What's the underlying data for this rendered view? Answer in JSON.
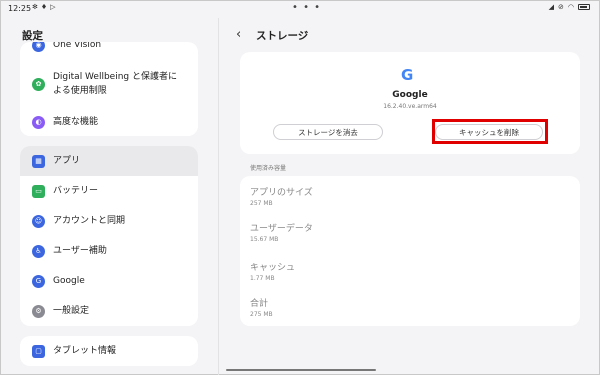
{
  "status_bar": {
    "time": "12:25",
    "left_icons": [
      "settings-small-icon",
      "wifi-small-icon",
      "play-store-small-icon"
    ],
    "center": "• • •"
  },
  "left_pane": {
    "title": "設定",
    "card1_items": [
      {
        "label": "One Vision",
        "icon": "vision-icon",
        "color": "#3b66e0"
      },
      {
        "label": "Digital Wellbeing と保護者に\nよる使用制限",
        "icon": "wellbeing-icon",
        "color": "#2fae5b"
      },
      {
        "label": "高度な機能",
        "icon": "advanced-features-icon",
        "color": "#8a5cf5"
      }
    ],
    "card2_items": [
      {
        "label": "アプリ",
        "icon": "apps-icon",
        "color": "#3b66e0"
      },
      {
        "label": "バッテリー",
        "icon": "battery-icon",
        "color": "#2fae5b"
      },
      {
        "label": "アカウントと同期",
        "icon": "account-icon",
        "color": "#3b66e0"
      },
      {
        "label": "ユーザー補助",
        "icon": "accessibility-icon",
        "color": "#3b66e0"
      },
      {
        "label": "Google",
        "icon": "google-icon",
        "color": "#3b66e0"
      },
      {
        "label": "一般設定",
        "icon": "general-settings-icon",
        "color": "#8a8a92"
      }
    ],
    "card3_items": [
      {
        "label": "タブレット情報",
        "icon": "tablet-info-icon",
        "color": "#3b66e0"
      }
    ]
  },
  "right_pane": {
    "title": "ストレージ",
    "app": {
      "name": "Google",
      "version": "16.2.40.ve.arm64",
      "logo": "G"
    },
    "buttons": {
      "clear_storage": "ストレージを消去",
      "clear_cache": "キャッシュを削除"
    },
    "section_label": "使用済み容量",
    "usage": [
      {
        "label": "アプリのサイズ",
        "value": "257 MB"
      },
      {
        "label": "ユーザーデータ",
        "value": "15.67 MB"
      },
      {
        "label": "キャッシュ",
        "value": "1.77 MB"
      },
      {
        "label": "合計",
        "value": "275 MB"
      }
    ]
  },
  "colors": {
    "highlight": "#e00000",
    "google_blue": "#4285f4"
  }
}
